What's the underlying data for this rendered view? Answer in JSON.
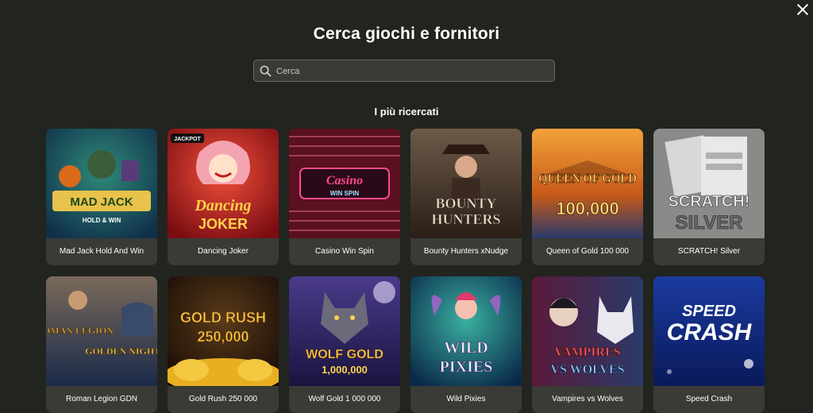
{
  "header": {
    "title": "Cerca giochi e fornitori"
  },
  "search": {
    "placeholder": "Cerca",
    "value": ""
  },
  "popular": {
    "heading": "I più ricercati",
    "games": [
      {
        "name": "Mad Jack Hold And Win",
        "art_l1": "MAD JACK",
        "art_l2": "HOLD & WIN",
        "badge": ""
      },
      {
        "name": "Dancing Joker",
        "art_l1": "Dancing",
        "art_l2": "JOKER",
        "badge": "JACKPOT"
      },
      {
        "name": "Casino Win Spin",
        "art_l1": "Casino",
        "art_l2": "WIN SPIN",
        "badge": ""
      },
      {
        "name": "Bounty Hunters xNudge",
        "art_l1": "BOUNTY",
        "art_l2": "HUNTERS",
        "badge": ""
      },
      {
        "name": "Queen of Gold 100 000",
        "art_l1": "QUEEN OF GOLD",
        "art_l2": "100,000",
        "badge": ""
      },
      {
        "name": "SCRATCH! Silver",
        "art_l1": "SCRATCH!",
        "art_l2": "SILVER",
        "badge": ""
      },
      {
        "name": "Roman Legion GDN",
        "art_l1": "ROMAN LEGION",
        "art_l2": "GOLDEN NIGHTS",
        "badge": ""
      },
      {
        "name": "Gold Rush 250 000",
        "art_l1": "GOLD RUSH",
        "art_l2": "250,000",
        "badge": ""
      },
      {
        "name": "Wolf Gold 1 000 000",
        "art_l1": "WOLF GOLD",
        "art_l2": "1,000,000",
        "badge": ""
      },
      {
        "name": "Wild Pixies",
        "art_l1": "WILD",
        "art_l2": "PIXIES",
        "badge": ""
      },
      {
        "name": "Vampires vs Wolves",
        "art_l1": "VAMPIRES",
        "art_l2": "VS WOLVES",
        "badge": ""
      },
      {
        "name": "Speed Crash",
        "art_l1": "SPEED",
        "art_l2": "CRASH",
        "badge": ""
      }
    ]
  },
  "icons": {
    "close": "close-icon",
    "search": "search-icon"
  }
}
